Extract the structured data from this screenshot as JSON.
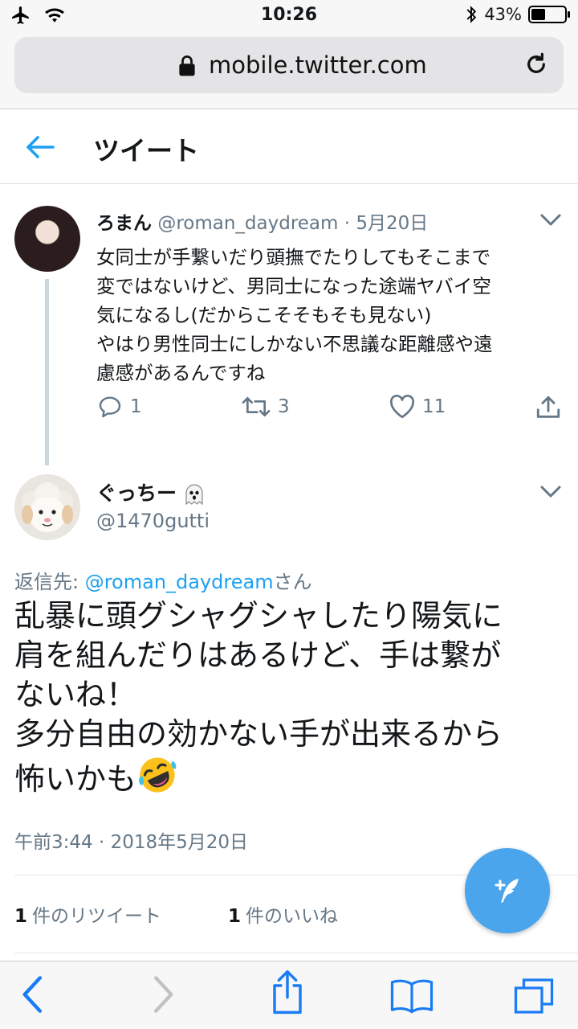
{
  "status_bar": {
    "time": "10:26",
    "battery_percent_label": "43%",
    "battery_level": 0.43,
    "icons": [
      "airplane-icon",
      "wifi-icon",
      "bluetooth-icon",
      "battery-icon"
    ]
  },
  "browser": {
    "url": "mobile.twitter.com",
    "icons": [
      "lock-icon",
      "reload-icon"
    ],
    "toolbar_icons": [
      "back-icon",
      "forward-icon",
      "share-icon",
      "bookmarks-icon",
      "tabs-icon"
    ]
  },
  "header": {
    "title": "ツイート"
  },
  "parent_tweet": {
    "name": "ろまん",
    "handle": "@roman_daydream",
    "separator": "·",
    "date": "5月20日",
    "text": "女同士が手繋いだり頭撫でたりしてもそこまで\n変ではないけど、男同士になった途端ヤバイ空\n気になるし(だからこそそもそも見ない)\nやはり男性同士にしかない不思議な距離感や遠\n慮感があるんですね",
    "replies": "1",
    "retweets": "3",
    "likes": "11"
  },
  "focal_tweet": {
    "name": "ぐっちー",
    "handle": "@1470gutti",
    "reply_prefix": "返信先: ",
    "reply_mention": "@roman_daydream",
    "reply_suffix": "さん",
    "text": "乱暴に頭グシャグシャしたり陽気に\n肩を組んだりはあるけど、手は繋が\nないね！\n多分自由の効かない手が出来るから\n怖いかも",
    "timestamp": "午前3:44 · 2018年5月20日",
    "retweet_count": "1",
    "retweet_label": "件のリツイート",
    "like_count": "1",
    "like_label": "件のいいね"
  },
  "colors": {
    "accent": "#1da1f2",
    "secondary_text": "#657786",
    "fab": "#4aa5ec",
    "browser_chrome": "#f7f7f7",
    "ios_blue": "#1a7cf5"
  }
}
